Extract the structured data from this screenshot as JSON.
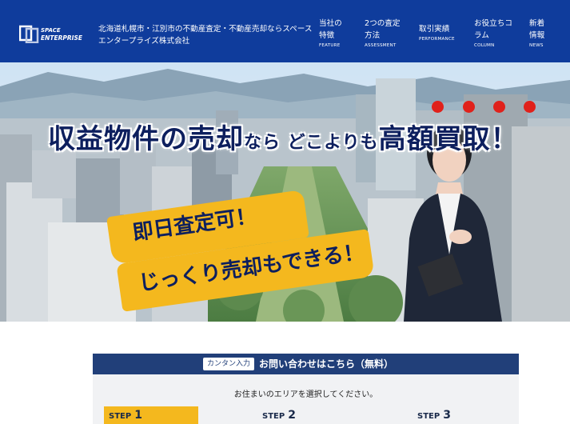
{
  "header": {
    "logo_alt": "SPACE ENTERPRISE",
    "tagline": "北海道札幌市・江別市の不動産査定・不動産売却ならスペースエンタープライズ株式会社",
    "nav": [
      {
        "label": "当社の特徴",
        "sub": "FEATURE"
      },
      {
        "label": "2つの査定方法",
        "sub": "ASSESSMENT"
      },
      {
        "label": "取引実績",
        "sub": "PERFORMANCE"
      },
      {
        "label": "お役立ちコラム",
        "sub": "COLUMN"
      },
      {
        "label": "新着情報",
        "sub": "NEWS"
      }
    ]
  },
  "hero": {
    "headline_a": "収益物件の売却",
    "headline_b": "なら",
    "headline_c": " どこよりも",
    "headline_d": "高額買取！",
    "catch_1": "即日査定可！",
    "catch_2": "じっくり売却もできる！"
  },
  "contact": {
    "badge": "カンタン入力",
    "title": "お問い合わせはこちら（無料）",
    "prompt": "お住まいのエリアを選択してください。",
    "steps": [
      {
        "word": "STEP",
        "num": "1",
        "active": true
      },
      {
        "word": "STEP",
        "num": "2",
        "active": false
      },
      {
        "word": "STEP",
        "num": "3",
        "active": false
      }
    ]
  },
  "colors": {
    "header_bg": "#0f3c9c",
    "panel_head": "#213f79",
    "accent_yellow": "#f4b81e",
    "dot_red": "#e0211b"
  }
}
